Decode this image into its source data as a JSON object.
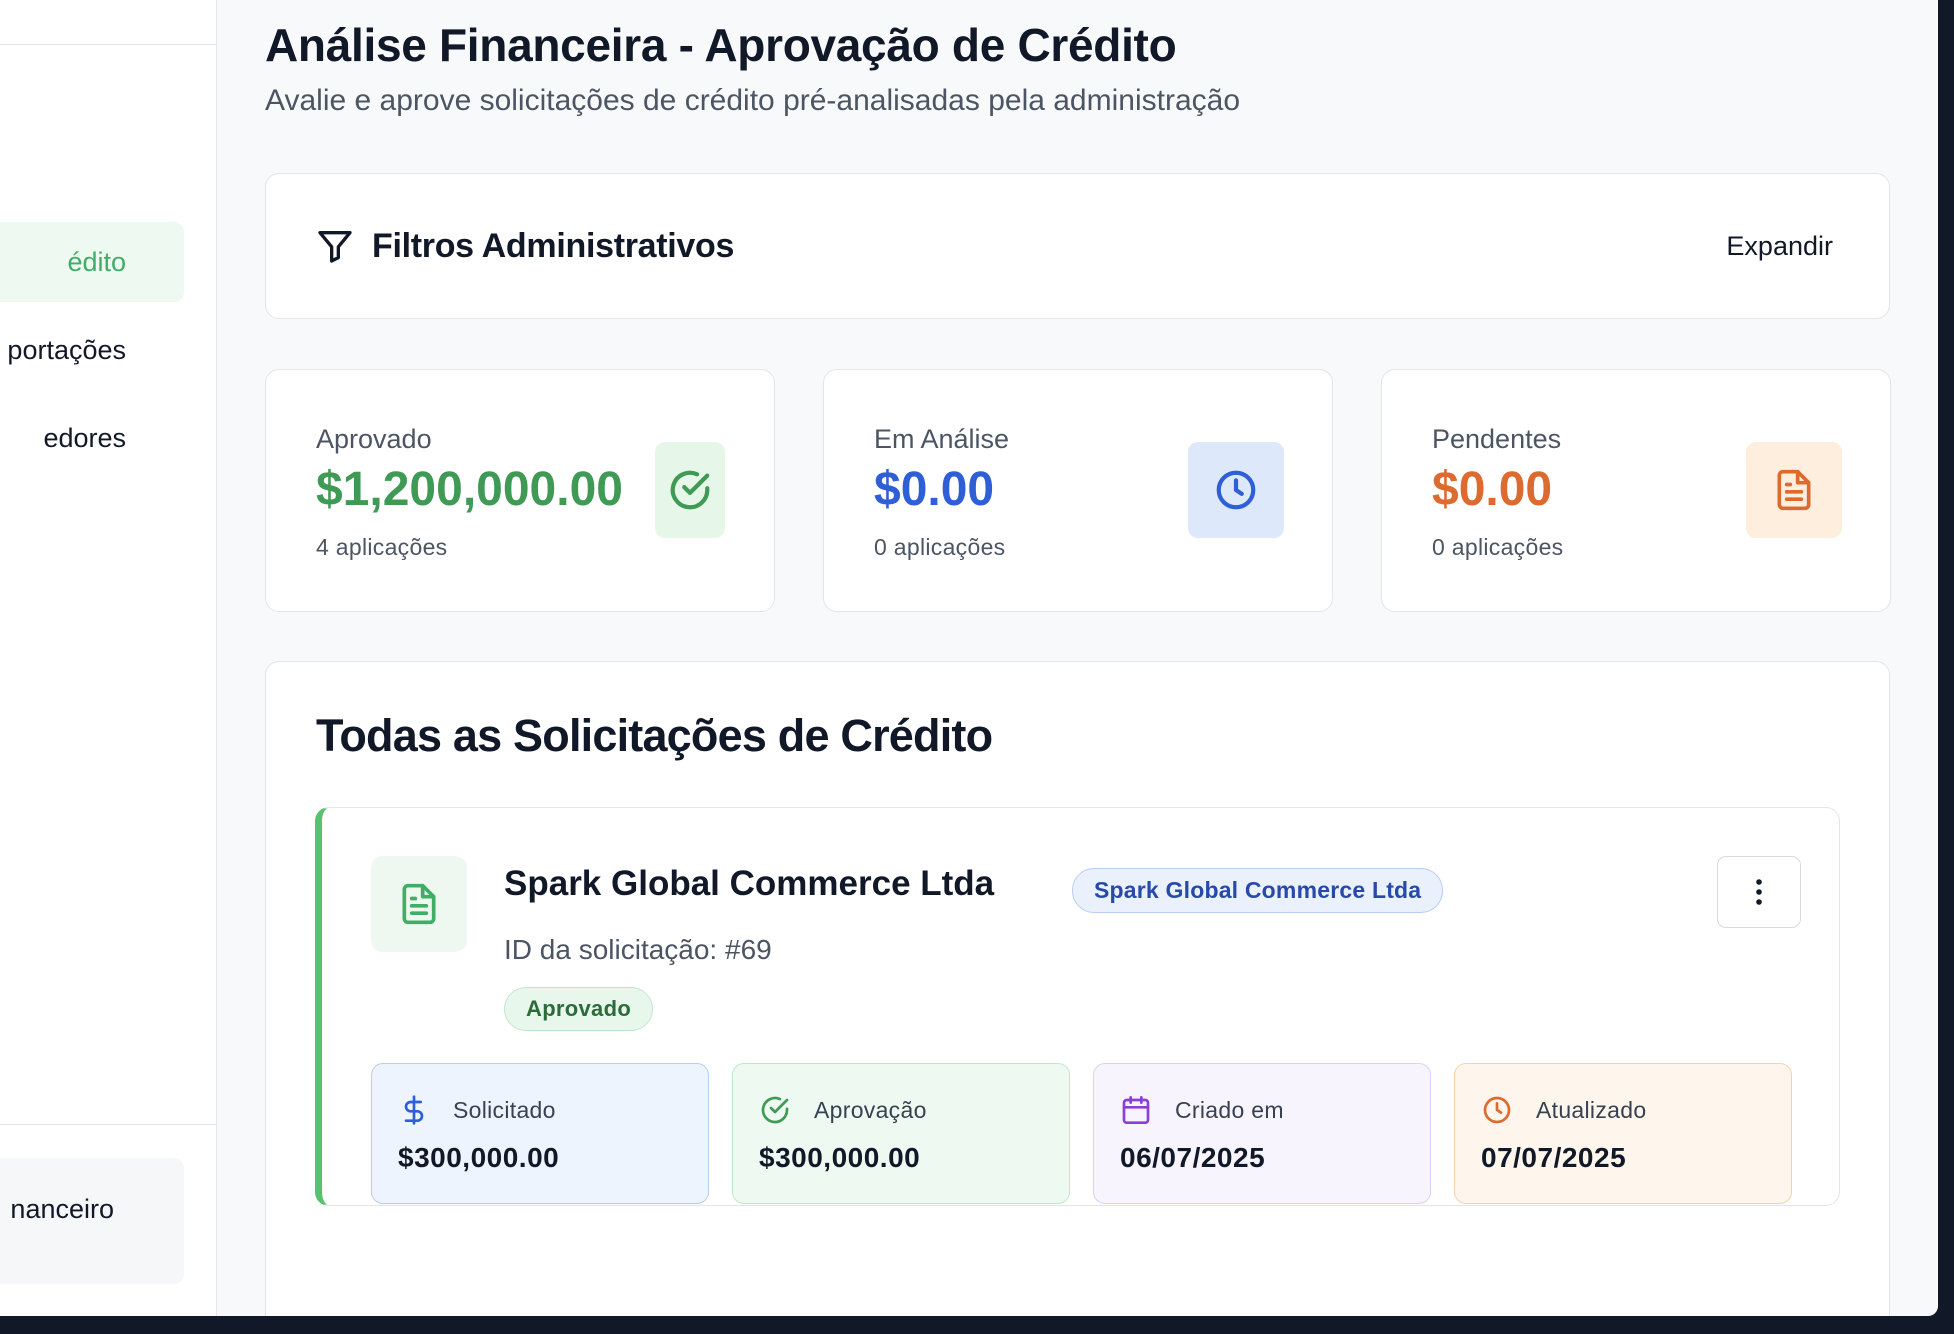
{
  "sidebar": {
    "items": [
      {
        "label": "édito",
        "active": true
      },
      {
        "label": "portações",
        "active": false
      },
      {
        "label": "edores",
        "active": false
      }
    ],
    "bottom_item": {
      "label": "nanceiro"
    }
  },
  "header": {
    "title": "Análise Financeira - Aprovação de Crédito",
    "subtitle": "Avalie e aprove solicitações de crédito pré-analisadas pela administração"
  },
  "filters": {
    "title": "Filtros Administrativos",
    "expand_label": "Expandir",
    "icon": "filter-icon"
  },
  "stats": [
    {
      "label": "Aprovado",
      "value": "$1,200,000.00",
      "sub": "4 aplicações",
      "color": "#3f9a55",
      "icon": "check-circle-icon"
    },
    {
      "label": "Em Análise",
      "value": "$0.00",
      "sub": "0 aplicações",
      "color": "#2f5fd6",
      "icon": "clock-icon"
    },
    {
      "label": "Pendentes",
      "value": "$0.00",
      "sub": "0 aplicações",
      "color": "#dd6a2e",
      "icon": "document-icon"
    }
  ],
  "requests": {
    "title": "Todas as Solicitações de Crédito",
    "items": [
      {
        "company": "Spark Global Commerce Ltda",
        "badge": "Spark Global Commerce Ltda",
        "request_id": "ID da solicitação: #69",
        "status": "Aprovado",
        "accent_color": "#58c26c",
        "metrics": [
          {
            "label": "Solicitado",
            "value": "$300,000.00",
            "icon": "dollar-icon"
          },
          {
            "label": "Aprovação",
            "value": "$300,000.00",
            "icon": "check-circle-icon"
          },
          {
            "label": "Criado em",
            "value": "06/07/2025",
            "icon": "calendar-icon"
          },
          {
            "label": "Atualizado",
            "value": "07/07/2025",
            "icon": "clock-icon"
          }
        ]
      }
    ]
  }
}
